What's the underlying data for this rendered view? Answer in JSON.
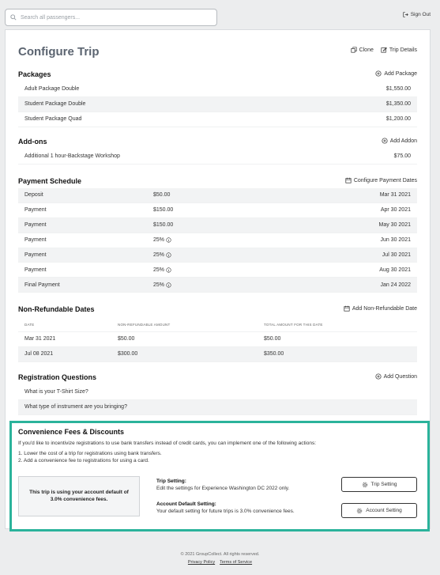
{
  "search": {
    "placeholder": "Search all passengers..."
  },
  "header": {
    "signout": "Sign Out"
  },
  "page": {
    "title": "Configure Trip",
    "clone": "Clone",
    "trip_details": "Trip Details"
  },
  "packages": {
    "title": "Packages",
    "action": "Add Package",
    "rows": [
      {
        "name": "Adult Package Double",
        "price": "$1,550.00"
      },
      {
        "name": "Student Package Double",
        "price": "$1,350.00"
      },
      {
        "name": "Student Package Quad",
        "price": "$1,200.00"
      }
    ]
  },
  "addons": {
    "title": "Add-ons",
    "action": "Add Addon",
    "rows": [
      {
        "name": "Additional 1 hour-Backstage Workshop",
        "price": "$75.00"
      }
    ]
  },
  "payments": {
    "title": "Payment Schedule",
    "action": "Configure Payment Dates",
    "rows": [
      {
        "label": "Deposit",
        "amount": "$50.00",
        "date": "Mar 31 2021"
      },
      {
        "label": "Payment",
        "amount": "$150.00",
        "date": "Apr 30 2021"
      },
      {
        "label": "Payment",
        "amount": "$150.00",
        "date": "May 30 2021"
      },
      {
        "label": "Payment",
        "amount": "25%",
        "date": "Jun 30 2021"
      },
      {
        "label": "Payment",
        "amount": "25%",
        "date": "Jul 30 2021"
      },
      {
        "label": "Payment",
        "amount": "25%",
        "date": "Aug 30 2021"
      },
      {
        "label": "Final Payment",
        "amount": "25%",
        "date": "Jan 24 2022"
      }
    ]
  },
  "nonref": {
    "title": "Non-Refundable Dates",
    "action": "Add Non-Refundable Date",
    "headers": [
      "DATE",
      "NON-REFUNDABLE AMOUNT",
      "TOTAL AMOUNT FOR THIS DATE"
    ],
    "rows": [
      {
        "date": "Mar 31 2021",
        "amount": "$50.00",
        "total": "$50.00"
      },
      {
        "date": "Jul 08 2021",
        "amount": "$300.00",
        "total": "$350.00"
      }
    ]
  },
  "questions": {
    "title": "Registration Questions",
    "action": "Add Question",
    "rows": [
      "What is your T-Shirt Size?",
      "What type of instrument are you bringing?"
    ]
  },
  "convenience": {
    "title": "Convenience Fees & Discounts",
    "desc": "If you'd like to incentivize registrations to use bank transfers instead of credit cards, you can implement one of the following actions:",
    "items": [
      "1. Lower the cost of a trip for registrations using bank transfers.",
      "2. Add a convenience fee to registrations for using a card."
    ],
    "default_note": "This trip is using your account default of 3.0% convenience fees.",
    "trip_setting_title": "Trip Setting:",
    "trip_setting_desc": "Edit the settings for Experience Washington DC 2022 only.",
    "account_setting_title": "Account Default Setting:",
    "account_setting_desc": "Your default setting for future trips is 3.0% convenience fees.",
    "trip_button": "Trip Setting",
    "account_button": "Account Setting"
  },
  "footer": {
    "copyright": "© 2021 GroupCollect. All rights reserved.",
    "privacy": "Privacy Policy",
    "terms": "Terms of Service"
  }
}
